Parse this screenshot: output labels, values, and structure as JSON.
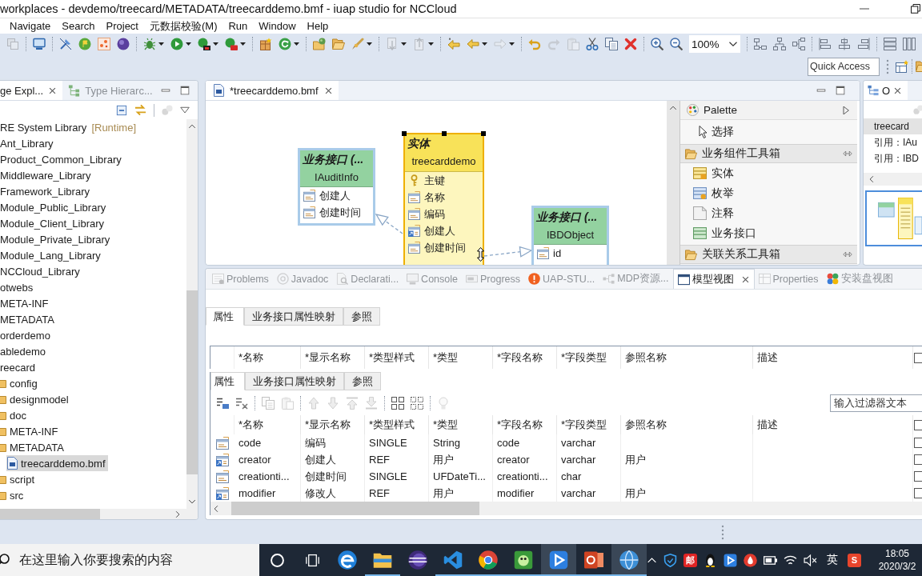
{
  "window": {
    "title": "workplaces - devdemo/treecard/METADATA/treecarddemo.bmf - iuap studio for NCCloud"
  },
  "menu": [
    "Navigate",
    "Search",
    "Project",
    "元数据校验(M)",
    "Run",
    "Window",
    "Help"
  ],
  "toolbar": {
    "groups": [
      [
        {
          "kind": "save-all",
          "disabled": true,
          "dropdown": false
        }
      ],
      [
        {
          "kind": "monitor",
          "disabled": false,
          "dropdown": false
        }
      ],
      [
        {
          "kind": "pin",
          "disabled": false,
          "dropdown": false
        },
        {
          "kind": "flag",
          "disabled": false,
          "dropdown": false
        },
        {
          "kind": "dots",
          "disabled": false,
          "dropdown": false
        },
        {
          "kind": "sphere",
          "disabled": false,
          "dropdown": false
        }
      ],
      [
        {
          "kind": "bug",
          "disabled": false,
          "dropdown": true
        },
        {
          "kind": "play",
          "disabled": false,
          "dropdown": true
        },
        {
          "kind": "run-ext",
          "disabled": false,
          "dropdown": true
        },
        {
          "kind": "run-stop",
          "disabled": false,
          "dropdown": true
        }
      ],
      [
        {
          "kind": "package",
          "disabled": false,
          "dropdown": false
        },
        {
          "kind": "refresh",
          "disabled": false,
          "dropdown": true
        }
      ],
      [
        {
          "kind": "folder-sphere",
          "disabled": false,
          "dropdown": false
        },
        {
          "kind": "folder-open",
          "disabled": false,
          "dropdown": false
        },
        {
          "kind": "brush",
          "disabled": false,
          "dropdown": true
        }
      ],
      [
        {
          "kind": "doc-down",
          "disabled": true,
          "dropdown": true
        },
        {
          "kind": "doc-up",
          "disabled": true,
          "dropdown": true
        }
      ],
      [
        {
          "kind": "back-star",
          "disabled": false,
          "dropdown": false
        },
        {
          "kind": "back",
          "disabled": false,
          "dropdown": true
        },
        {
          "kind": "forward",
          "disabled": true,
          "dropdown": true
        }
      ],
      [
        {
          "kind": "undo",
          "disabled": false,
          "dropdown": false
        },
        {
          "kind": "redo",
          "disabled": true,
          "dropdown": false
        },
        {
          "kind": "paste",
          "disabled": true,
          "dropdown": false
        },
        {
          "kind": "cut",
          "disabled": false,
          "dropdown": false
        },
        {
          "kind": "copy",
          "disabled": false,
          "dropdown": false
        },
        {
          "kind": "delete",
          "disabled": false,
          "dropdown": false
        }
      ],
      [
        {
          "kind": "zoom-in",
          "disabled": false,
          "dropdown": false
        },
        {
          "kind": "zoom-out",
          "disabled": false,
          "dropdown": false
        },
        {
          "kind": "combo",
          "value": "100%"
        }
      ],
      [
        {
          "kind": "layout-a",
          "disabled": false,
          "dropdown": false
        },
        {
          "kind": "layout-b",
          "disabled": false,
          "dropdown": false
        },
        {
          "kind": "layout-c",
          "disabled": false,
          "dropdown": false
        }
      ],
      [
        {
          "kind": "align-a",
          "disabled": false,
          "dropdown": false
        },
        {
          "kind": "align-b",
          "disabled": false,
          "dropdown": false
        },
        {
          "kind": "align-c",
          "disabled": false,
          "dropdown": false
        }
      ],
      [
        {
          "kind": "rows",
          "disabled": false,
          "dropdown": false
        },
        {
          "kind": "cols",
          "disabled": false,
          "dropdown": false
        }
      ]
    ],
    "quick_access": {
      "placeholder": "Quick Access"
    }
  },
  "explorer": {
    "tabs": [
      {
        "label": "ge Expl...",
        "kind": "explorer",
        "selected": true
      },
      {
        "label": "Type Hierarc...",
        "kind": "hierarchy",
        "selected": false
      }
    ],
    "tree": [
      {
        "label": "RE System Library",
        "decoration": "[Runtime]",
        "selected": false
      },
      {
        "label": "Ant_Library",
        "selected": false
      },
      {
        "label": "Product_Common_Library",
        "selected": false
      },
      {
        "label": "Middleware_Library",
        "selected": false
      },
      {
        "label": "Framework_Library",
        "selected": false
      },
      {
        "label": "Module_Public_Library",
        "selected": false
      },
      {
        "label": "Module_Client_Library",
        "selected": false
      },
      {
        "label": "Module_Private_Library",
        "selected": false
      },
      {
        "label": "Module_Lang_Library",
        "selected": false
      },
      {
        "label": "NCCloud_Library",
        "selected": false
      },
      {
        "label": "otwebs",
        "selected": false
      },
      {
        "label": "META-INF",
        "selected": false
      },
      {
        "label": "METADATA",
        "selected": false
      },
      {
        "label": "orderdemo",
        "selected": false
      },
      {
        "label": "abledemo",
        "selected": false
      },
      {
        "label": "reecard",
        "selected": false,
        "children": [
          {
            "label": "config",
            "kind": "folder",
            "selected": false
          },
          {
            "label": "designmodel",
            "kind": "folder",
            "selected": false
          },
          {
            "label": "doc",
            "kind": "folder",
            "selected": false
          },
          {
            "label": "META-INF",
            "kind": "folder",
            "selected": false
          },
          {
            "label": "METADATA",
            "kind": "folder",
            "selected": false,
            "children": [
              {
                "label": "treecarddemo.bmf",
                "kind": "file",
                "selected": true
              }
            ]
          },
          {
            "label": "script",
            "kind": "folder",
            "selected": false
          },
          {
            "label": "src",
            "kind": "folder",
            "selected": false
          }
        ]
      }
    ]
  },
  "editor": {
    "tab": {
      "label": "*treecarddemo.bmf",
      "selected": true
    },
    "diagram": {
      "nodes": [
        {
          "kind": "interface",
          "stereotype": "业务接口 (...",
          "name": "IAuditInfo",
          "selected": false,
          "attributes": [
            {
              "kind": "field",
              "label": "创建人"
            },
            {
              "kind": "field",
              "label": "创建时间"
            }
          ]
        },
        {
          "kind": "entity",
          "stereotype": "实体",
          "name": "treecarddemo",
          "selected": true,
          "attributes": [
            {
              "kind": "key",
              "label": "主键"
            },
            {
              "kind": "field",
              "label": "名称"
            },
            {
              "kind": "field",
              "label": "编码"
            },
            {
              "kind": "ref",
              "label": "创建人"
            },
            {
              "kind": "field",
              "label": "创建时间"
            }
          ]
        },
        {
          "kind": "interface",
          "stereotype": "业务接口 (...",
          "name": "IBDObject",
          "selected": false,
          "attributes": [
            {
              "kind": "field",
              "label": "id"
            }
          ]
        }
      ],
      "links": [
        {
          "kind": "realization"
        },
        {
          "kind": "realization"
        }
      ]
    },
    "palette": {
      "title": "Palette",
      "tool": "选择",
      "drawers": [
        {
          "label": "业务组件工具箱",
          "items": [
            {
              "kind": "entity",
              "label": "实体"
            },
            {
              "kind": "enum",
              "label": "枚举"
            },
            {
              "kind": "note",
              "label": "注释"
            },
            {
              "kind": "interface",
              "label": "业务接口"
            }
          ]
        },
        {
          "label": "关联关系工具箱"
        }
      ]
    }
  },
  "outline": {
    "tab": {
      "label": "O",
      "selected": true
    },
    "rows": [
      {
        "label": "treecard",
        "selected": true
      },
      {
        "label": "引用：IAu",
        "selected": false
      },
      {
        "label": "引用：IBD",
        "selected": false
      }
    ]
  },
  "views": {
    "tabs": [
      {
        "label": "Problems",
        "kind": "problems",
        "selected": false
      },
      {
        "label": "Javadoc",
        "kind": "javadoc",
        "selected": false
      },
      {
        "label": "Declarati...",
        "kind": "declaration",
        "selected": false
      },
      {
        "label": "Console",
        "kind": "console",
        "selected": false
      },
      {
        "label": "Progress",
        "kind": "progress",
        "selected": false
      },
      {
        "label": "UAP-STU...",
        "kind": "alert",
        "selected": false
      },
      {
        "label": "MDP资源...",
        "kind": "resources",
        "selected": false
      },
      {
        "label": "模型视图",
        "kind": "model",
        "selected": true
      },
      {
        "label": "Properties",
        "kind": "properties",
        "selected": false
      },
      {
        "label": "安装盘视图",
        "kind": "install",
        "selected": false
      }
    ],
    "upper_subtabs": [
      {
        "label": "属性",
        "selected": true
      },
      {
        "label": "业务接口属性映射",
        "selected": false
      },
      {
        "label": "参照",
        "selected": false
      }
    ],
    "upper_columns": [
      "*名称",
      "*显示名称",
      "*类型样式",
      "*类型",
      "*字段名称",
      "*字段类型",
      "参照名称",
      "描述"
    ],
    "subtabs": [
      {
        "label": "属性",
        "selected": true
      },
      {
        "label": "业务接口属性映射",
        "selected": false
      },
      {
        "label": "参照",
        "selected": false
      }
    ],
    "toolbar": [
      [
        {
          "kind": "add-row",
          "disabled": false
        },
        {
          "kind": "remove-row",
          "disabled": false
        }
      ],
      [
        {
          "kind": "copy",
          "disabled": true
        },
        {
          "kind": "paste",
          "disabled": true
        }
      ],
      [
        {
          "kind": "move-up",
          "disabled": true
        },
        {
          "kind": "move-down",
          "disabled": true
        },
        {
          "kind": "move-top",
          "disabled": true
        },
        {
          "kind": "move-bottom",
          "disabled": true
        }
      ],
      [
        {
          "kind": "grid-a",
          "disabled": false
        },
        {
          "kind": "grid-b",
          "disabled": false
        }
      ],
      [
        {
          "kind": "bulb",
          "disabled": true
        }
      ]
    ],
    "filter": {
      "placeholder": "输入过滤器文本"
    },
    "columns": [
      "*名称",
      "*显示名称",
      "*类型样式",
      "*类型",
      "*字段名称",
      "*字段类型",
      "参照名称",
      "描述"
    ],
    "rows": [
      {
        "kind": "field",
        "name": "code",
        "display": "编码",
        "style": "SINGLE",
        "type": "String",
        "column": "code",
        "column_type": "varchar",
        "checked": false
      },
      {
        "kind": "ref",
        "name": "creator",
        "display": "创建人",
        "style": "REF",
        "type": "用户",
        "column": "creator",
        "column_type": "varchar",
        "ref": "用户",
        "checked": false
      },
      {
        "kind": "field",
        "name": "creationti...",
        "display": "创建时间",
        "style": "SINGLE",
        "type": "UFDateTi...",
        "column": "creationti...",
        "column_type": "char",
        "checked": false
      },
      {
        "kind": "ref",
        "name": "modifier",
        "display": "修改人",
        "style": "REF",
        "type": "用户",
        "column": "modifier",
        "column_type": "varchar",
        "ref": "用户",
        "checked": false
      }
    ]
  },
  "taskbar": {
    "search": {
      "placeholder": "在这里输入你要搜索的内容"
    },
    "apps": [
      {
        "kind": "edge",
        "running": false,
        "active": false
      },
      {
        "kind": "explorer",
        "running": true,
        "active": false
      },
      {
        "kind": "eclipse",
        "running": false,
        "active": false
      },
      {
        "kind": "vscode",
        "running": true,
        "active": false
      },
      {
        "kind": "chrome",
        "running": true,
        "active": false
      },
      {
        "kind": "sheet",
        "running": true,
        "active": false
      },
      {
        "kind": "player",
        "running": true,
        "active": true
      },
      {
        "kind": "slides",
        "running": true,
        "active": false
      },
      {
        "kind": "studio",
        "running": true,
        "active": true
      }
    ],
    "tray": {
      "mail": "邮",
      "ime": "英",
      "logo": "S"
    },
    "clock": {
      "time": "18:05",
      "date": "2020/3/2"
    }
  }
}
